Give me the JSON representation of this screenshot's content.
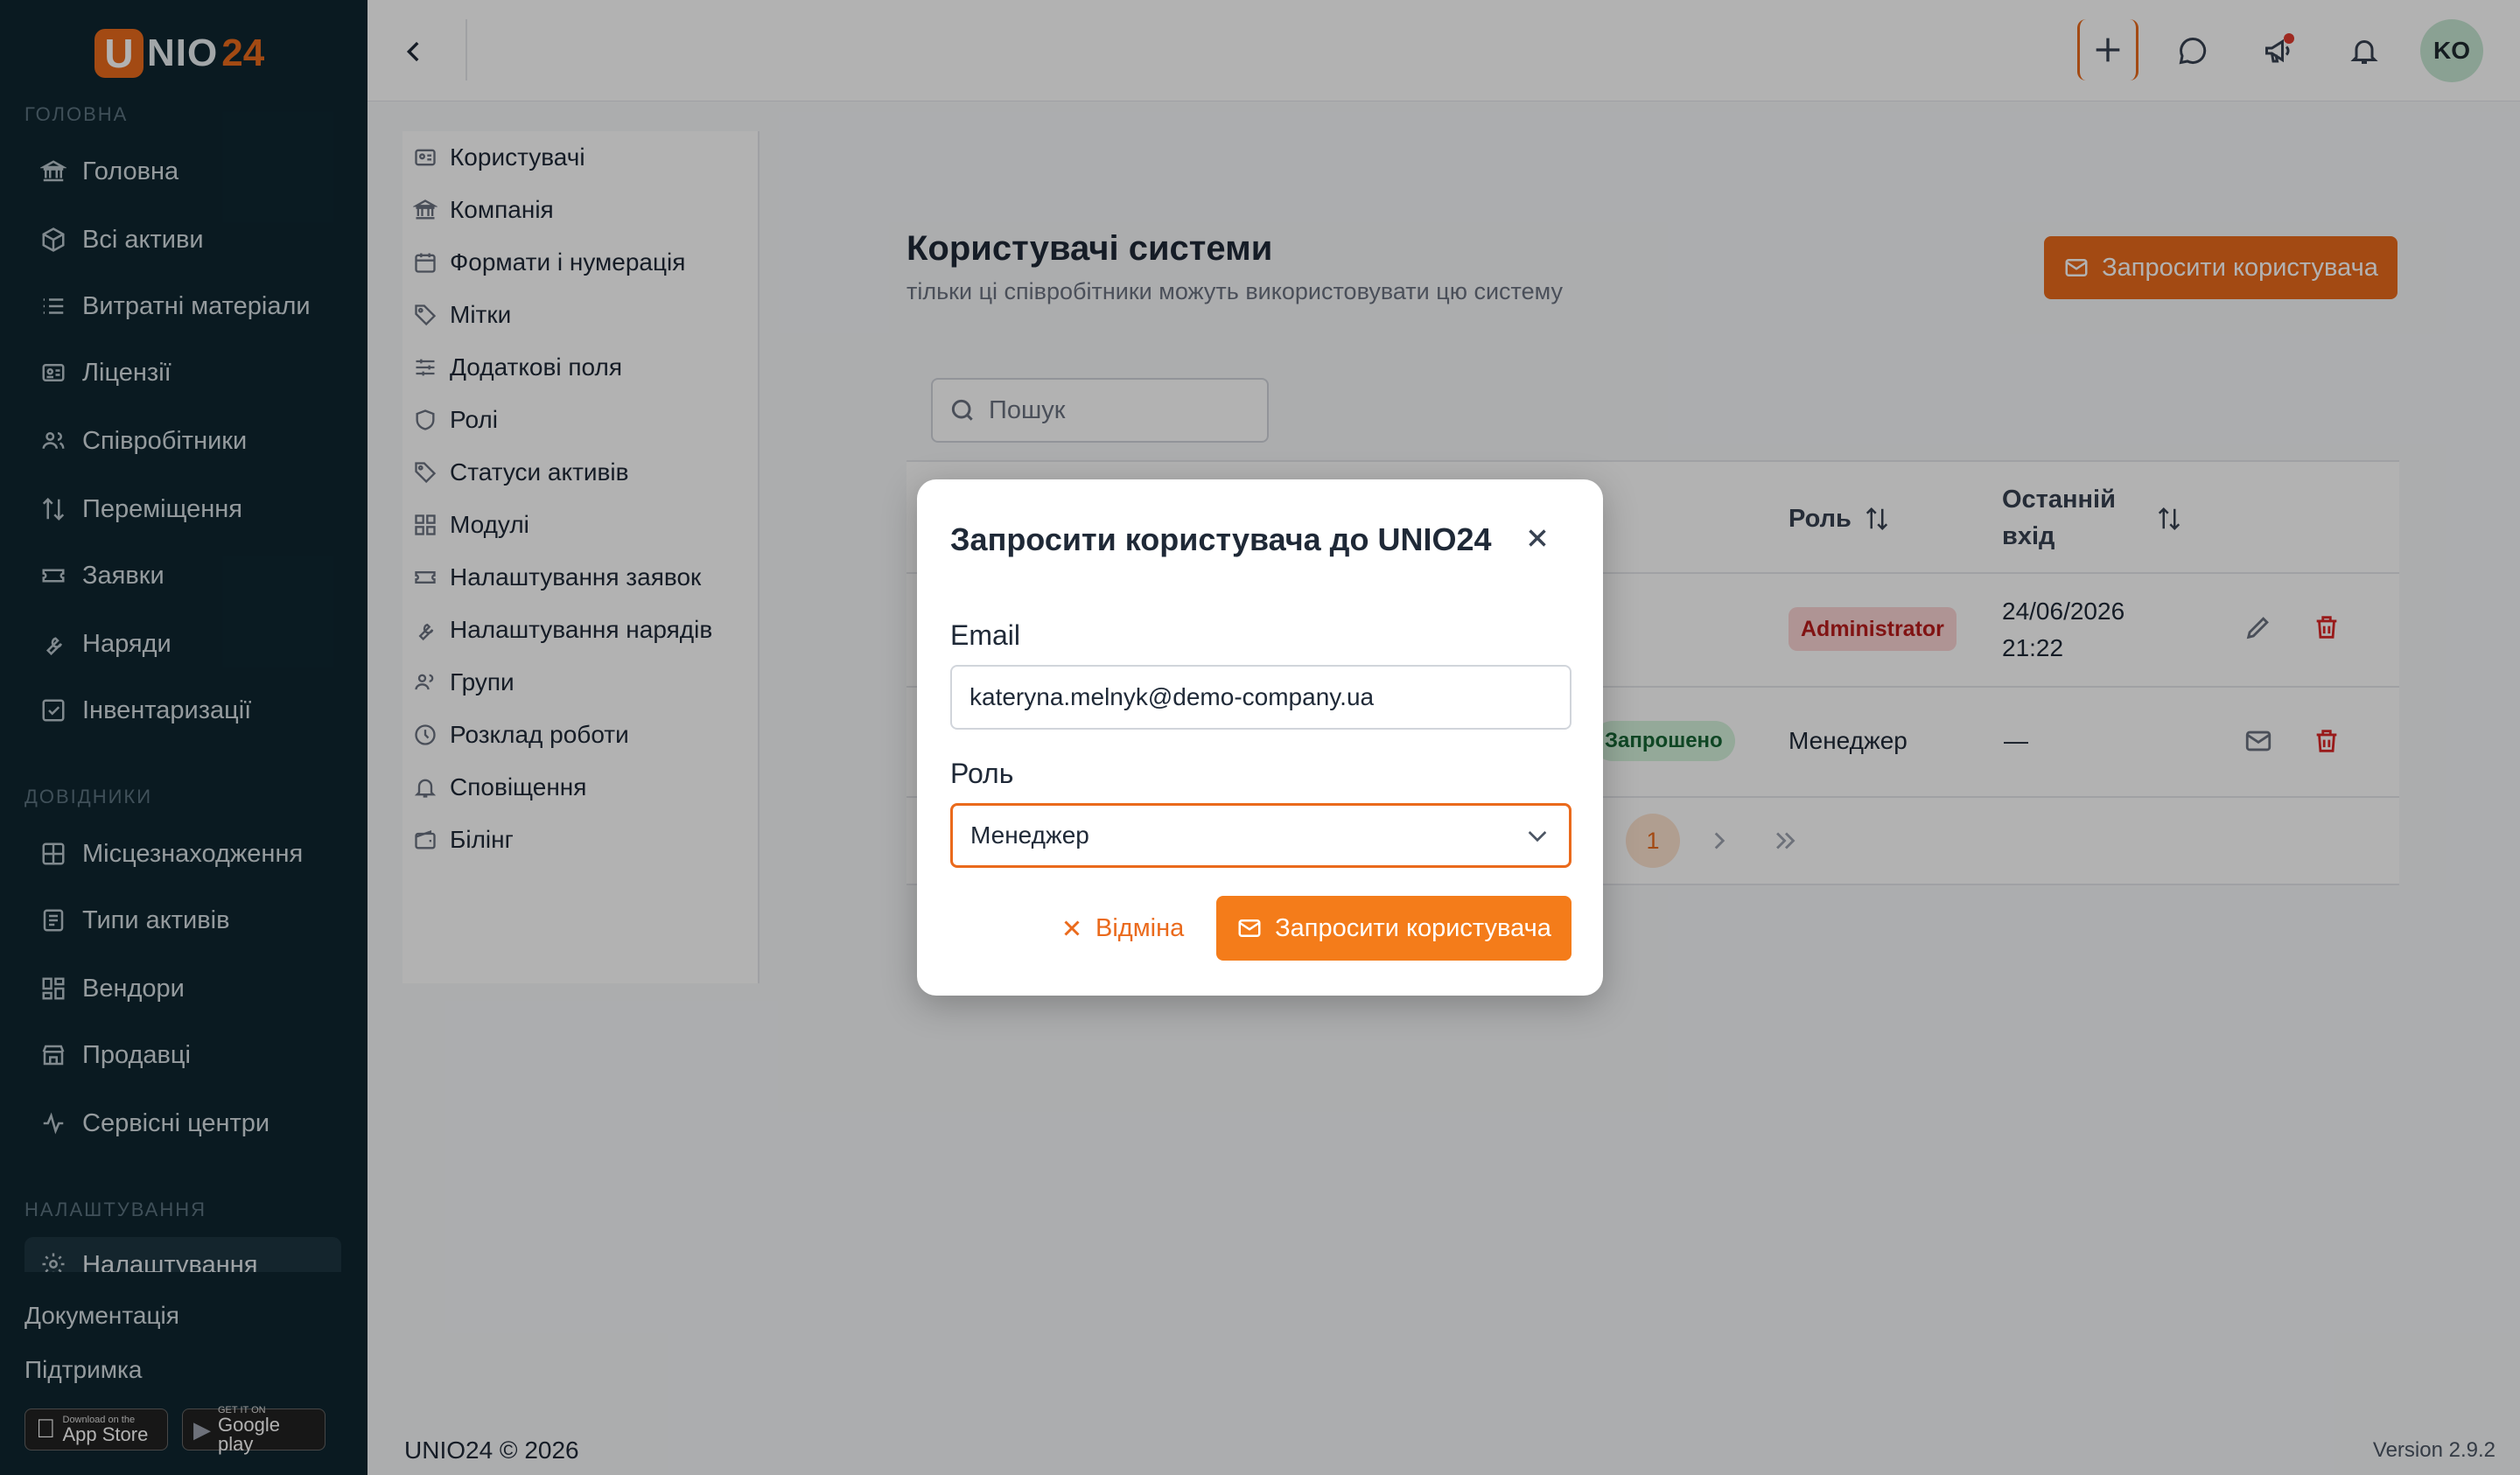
{
  "app": {
    "logo_u": "U",
    "logo_nio": "NIO",
    "logo_24": "24"
  },
  "sidebar": {
    "sections": [
      {
        "title": "ГОЛОВНА",
        "items": [
          "Головна",
          "Всі активи",
          "Витратні матеріали",
          "Ліцензії",
          "Співробітники",
          "Переміщення",
          "Заявки",
          "Наряди",
          "Інвентаризації"
        ]
      },
      {
        "title": "ДОВІДНИКИ",
        "items": [
          "Місцезнаходження",
          "Типи активів",
          "Вендори",
          "Продавці",
          "Сервісні центри"
        ]
      },
      {
        "title": "НАЛАШТУВАННЯ",
        "items": [
          "Налаштування"
        ]
      }
    ],
    "links": [
      "Документація",
      "Підтримка"
    ],
    "app_store": {
      "small": "Download on the",
      "big": "App Store"
    },
    "google_play": {
      "small": "GET IT ON",
      "big": "Google play"
    }
  },
  "topbar": {
    "avatar": "KO"
  },
  "settings_menu": [
    "Користувачі",
    "Компанія",
    "Формати і нумерація",
    "Мітки",
    "Додаткові поля",
    "Ролі",
    "Статуси активів",
    "Модулі",
    "Налаштування заявок",
    "Налаштування нарядів",
    "Групи",
    "Розклад роботи",
    "Сповіщення",
    "Білінг"
  ],
  "main": {
    "title": "Користувачі системи",
    "subtitle": "тільки ці співробітники можуть використовувати цю систему",
    "invite_button": "Запросити користувача",
    "search_placeholder": "Пошук",
    "table": {
      "headers": {
        "role": "Роль",
        "last_login_1": "Останній",
        "last_login_2": "вхід"
      },
      "rows": [
        {
          "role": "Administrator",
          "last_login_date": "24/06/2026",
          "last_login_time": "21:22"
        },
        {
          "status": "Запрошено",
          "role": "Менеджер",
          "last_login": "—"
        }
      ]
    },
    "pagination": {
      "current": "1"
    }
  },
  "footer": {
    "copyright": "UNIO24 © 2026",
    "version": "Version 2.9.2"
  },
  "modal": {
    "title": "Запросити користувача до UNIO24",
    "email_label": "Email",
    "email_value": "kateryna.melnyk@demo-company.ua",
    "role_label": "Роль",
    "role_value": "Менеджер",
    "cancel": "Відміна",
    "submit": "Запросити користувача"
  },
  "colors": {
    "accent": "#ea6a1c",
    "sidebar_bg": "#0f2630"
  }
}
